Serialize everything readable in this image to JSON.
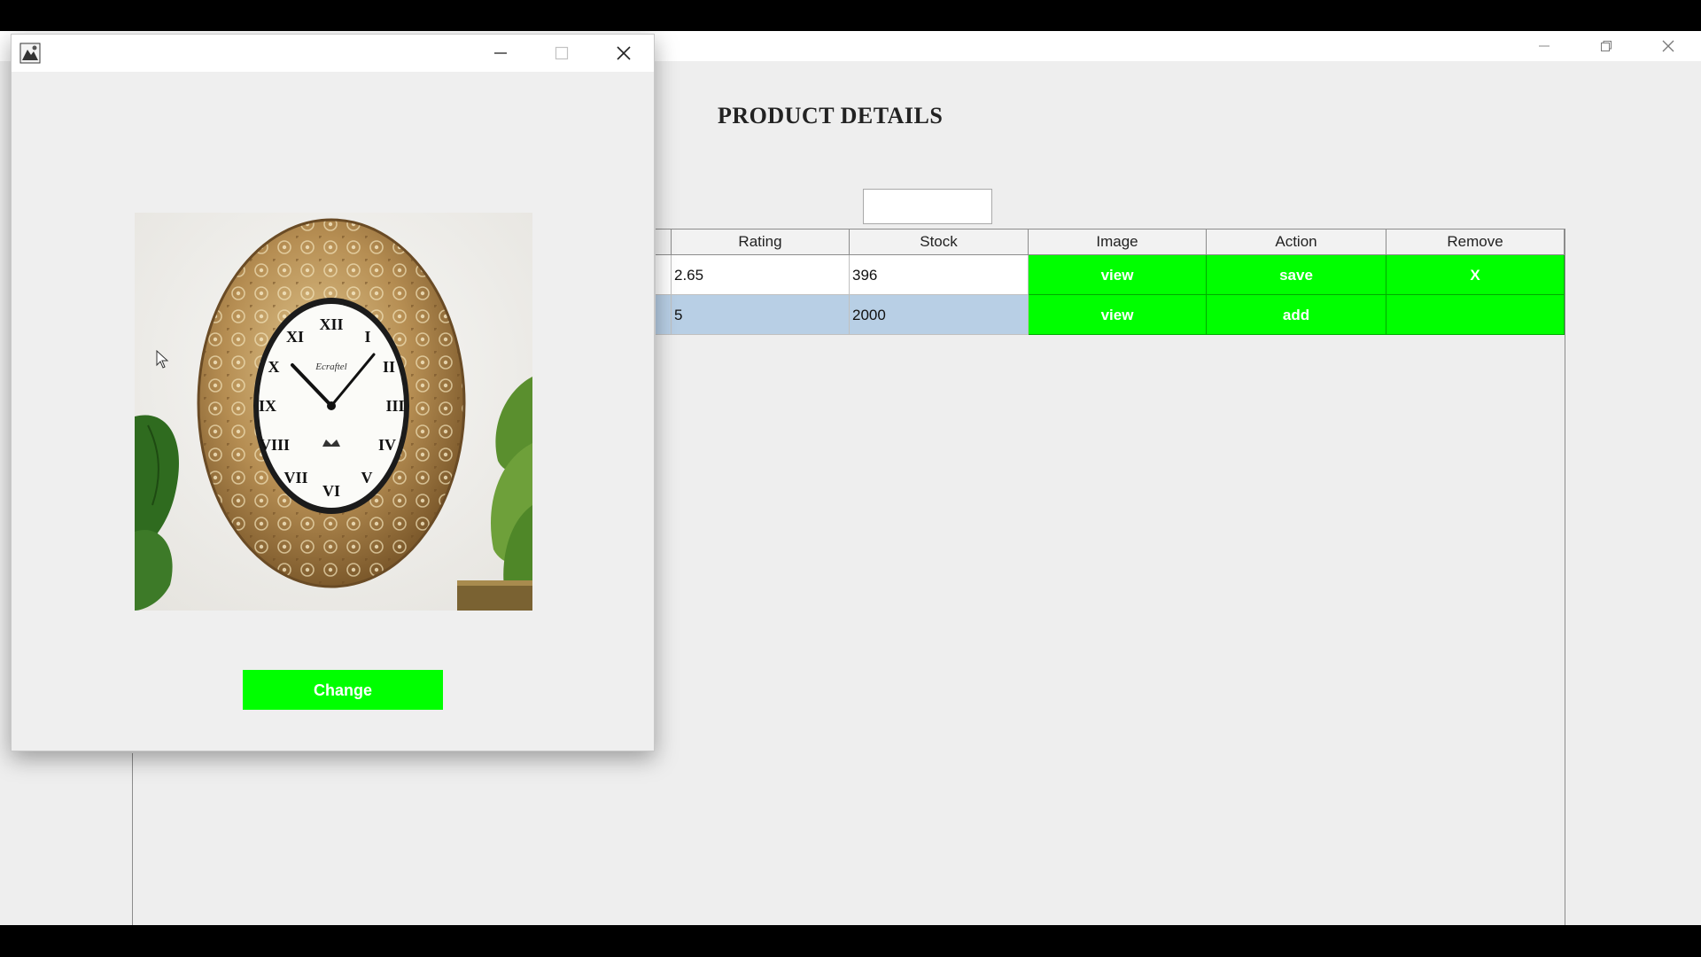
{
  "main_window": {
    "title_heading": "PRODUCT DETAILS",
    "search_value": "",
    "controls": {
      "minimize": "minimize-icon",
      "restore": "restore-icon",
      "close": "close-icon"
    }
  },
  "table": {
    "columns": [
      "Rating",
      "Stock",
      "Image",
      "Action",
      "Remove"
    ],
    "rows": [
      {
        "rating": "2.65",
        "stock": "396",
        "image": "view",
        "action": "save",
        "remove": "X",
        "selected": false
      },
      {
        "rating": "5",
        "stock": "2000",
        "image": "view",
        "action": "add",
        "remove": "",
        "selected": true
      }
    ]
  },
  "dialog": {
    "icon": "app-icon",
    "image": "wall-clock-product-image",
    "change_label": "Change",
    "controls": {
      "minimize": "minimize-icon",
      "maximize": "maximize-icon",
      "close": "close-icon"
    }
  },
  "colors": {
    "accent_button": "#00ff00",
    "selected_row": "#b8cfe5",
    "window_bg": "#eeeeee"
  }
}
